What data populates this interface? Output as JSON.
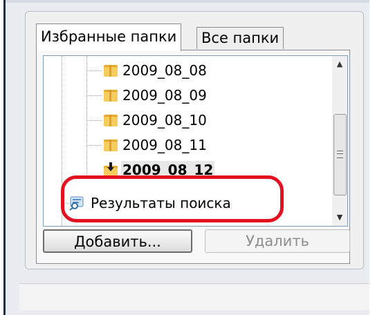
{
  "tabs": [
    {
      "label": "Избранные папки",
      "active": true
    },
    {
      "label": "Все папки",
      "active": false
    }
  ],
  "tree": {
    "folders": [
      {
        "name": "2009_08_08",
        "icon": "folder-icon"
      },
      {
        "name": "2009_08_09",
        "icon": "folder-icon"
      },
      {
        "name": "2009_08_10",
        "icon": "folder-icon"
      },
      {
        "name": "2009_08_11",
        "icon": "folder-icon"
      },
      {
        "name": "2009_08_12",
        "icon": "folder-download-icon",
        "selected": true
      }
    ],
    "search_results": {
      "label": "Результаты поиска",
      "icon": "search-results-icon"
    }
  },
  "scrollbar": {
    "up_glyph": "▲",
    "down_glyph": "▼"
  },
  "buttons": {
    "add": "Добавить...",
    "delete": "Удалить"
  },
  "colors": {
    "highlight": "#e5101f",
    "folder": "#f0c24e"
  }
}
